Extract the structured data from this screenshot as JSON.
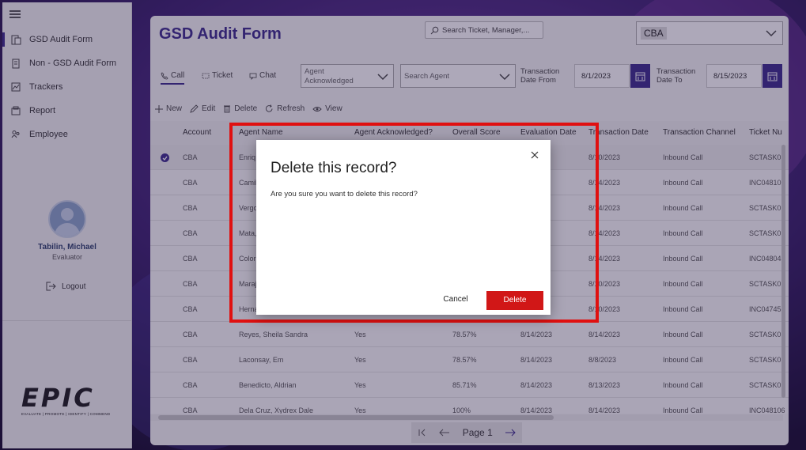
{
  "sidebar": {
    "items": [
      {
        "label": "GSD Audit Form",
        "icon": "form-icon"
      },
      {
        "label": "Non - GSD Audit Form",
        "icon": "document-icon"
      },
      {
        "label": "Trackers",
        "icon": "chart-icon"
      },
      {
        "label": "Report",
        "icon": "report-icon"
      },
      {
        "label": "Employee",
        "icon": "people-icon"
      }
    ],
    "profile_name": "Tabilin, Michael",
    "profile_role": "Evaluator",
    "logout_label": "Logout",
    "logo_word": "EPIC",
    "logo_tagline": "EVALUATE | PROMOTE | IDENTIFY | COMMEND"
  },
  "header": {
    "title": "GSD Audit Form",
    "search_placeholder": "Search Ticket, Manager,...",
    "account_selected": "CBA"
  },
  "tabs": [
    {
      "label": "Call"
    },
    {
      "label": "Ticket"
    },
    {
      "label": "Chat"
    }
  ],
  "filters": {
    "agent_ack_value": "Agent Acknowledged",
    "search_agent_placeholder": "Search Agent",
    "date_from_label": "Transaction Date From",
    "date_from_value": "8/1/2023",
    "date_to_label": "Transaction Date To",
    "date_to_value": "8/15/2023"
  },
  "toolbar": {
    "new_label": "New",
    "edit_label": "Edit",
    "delete_label": "Delete",
    "refresh_label": "Refresh",
    "view_label": "View"
  },
  "table": {
    "headers": [
      "Account",
      "Agent Name",
      "Agent Acknowledged?",
      "Overall Score",
      "Evaluation Date",
      "Transaction Date",
      "Transaction Channel",
      "Ticket Nu"
    ],
    "rows": [
      [
        "CBA",
        "Enriq",
        "",
        "",
        "3",
        "8/10/2023",
        "Inbound Call",
        "SCTASK01"
      ],
      [
        "CBA",
        "Camil",
        "",
        "",
        "3",
        "8/14/2023",
        "Inbound Call",
        "INC048107"
      ],
      [
        "CBA",
        "Vergo",
        "",
        "",
        "3",
        "8/14/2023",
        "Inbound Call",
        "SCTASK01"
      ],
      [
        "CBA",
        "Mata,",
        "",
        "",
        "3",
        "8/14/2023",
        "Inbound Call",
        "SCTASK01"
      ],
      [
        "CBA",
        "Color",
        "",
        "",
        "3",
        "8/14/2023",
        "Inbound Call",
        "INC048041"
      ],
      [
        "CBA",
        "Maraj",
        "",
        "",
        "3",
        "8/10/2023",
        "Inbound Call",
        "SCTASK01"
      ],
      [
        "CBA",
        "Herna",
        "",
        "",
        "3",
        "8/10/2023",
        "Inbound Call",
        "INC04745"
      ],
      [
        "CBA",
        "Reyes, Sheila Sandra",
        "Yes",
        "78.57%",
        "8/14/2023",
        "8/14/2023",
        "Inbound Call",
        "SCTASK01"
      ],
      [
        "CBA",
        "Laconsay, Em",
        "Yes",
        "78.57%",
        "8/14/2023",
        "8/8/2023",
        "Inbound Call",
        "SCTASK01"
      ],
      [
        "CBA",
        "Benedicto, Aldrian",
        "Yes",
        "85.71%",
        "8/14/2023",
        "8/13/2023",
        "Inbound Call",
        "SCTASK01"
      ],
      [
        "CBA",
        "Dela Cruz, Xydrex Dale",
        "Yes",
        "100%",
        "8/14/2023",
        "8/14/2023",
        "Inbound Call",
        "INC048106"
      ]
    ]
  },
  "pager": {
    "label": "Page 1"
  },
  "dialog": {
    "title": "Delete this record?",
    "message": "Are you sure you want to delete this record?",
    "cancel_label": "Cancel",
    "delete_label": "Delete"
  },
  "colors": {
    "brand": "#3b2b8c",
    "danger": "#d11717",
    "highlight": "#e01010"
  }
}
